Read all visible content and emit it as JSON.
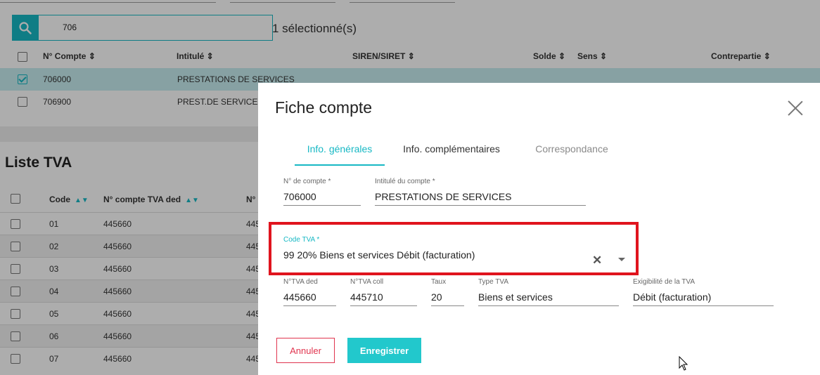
{
  "accounts_panel": {
    "search": {
      "value": "706",
      "icon": "search-icon"
    },
    "selected_text": "1 sélectionné(s)",
    "columns": [
      "N° Compte",
      "Intitulé",
      "SIREN/SIRET",
      "Solde",
      "Sens",
      "Contrepartie"
    ],
    "rows": [
      {
        "num": "706000",
        "label": "PRESTATIONS DE SERVICES",
        "checked": true
      },
      {
        "num": "706900",
        "label": "PREST.DE SERVICES",
        "checked": false
      }
    ]
  },
  "liste_tva": {
    "title": "Liste TVA",
    "columns": [
      "Code",
      "N° compte TVA ded",
      "N°"
    ],
    "rows": [
      {
        "code": "01",
        "ded": "445660",
        "coll": "445"
      },
      {
        "code": "02",
        "ded": "445660",
        "coll": "445"
      },
      {
        "code": "03",
        "ded": "445660",
        "coll": "445"
      },
      {
        "code": "04",
        "ded": "445660",
        "coll": "445"
      },
      {
        "code": "05",
        "ded": "445660",
        "coll": "445"
      },
      {
        "code": "06",
        "ded": "445660",
        "coll": "445"
      },
      {
        "code": "07",
        "ded": "445660",
        "coll": "445"
      }
    ]
  },
  "modal": {
    "title": "Fiche compte",
    "tabs": [
      "Info. générales",
      "Info. complémentaires",
      "Correspondance"
    ],
    "fields": {
      "num_compte": {
        "label": "N° de compte *",
        "value": "706000"
      },
      "intitule": {
        "label": "Intitulé du compte *",
        "value": "PRESTATIONS DE SERVICES"
      },
      "code_tva": {
        "label": "Code TVA *",
        "value": "99 20% Biens et services Débit (facturation)"
      },
      "tva_ded": {
        "label": "N°TVA ded",
        "value": "445660"
      },
      "tva_coll": {
        "label": "N°TVA coll",
        "value": "445710"
      },
      "taux": {
        "label": "Taux",
        "value": "20"
      },
      "type_tva": {
        "label": "Type TVA",
        "value": "Biens et services"
      },
      "exigibilite": {
        "label": "Exigibilité de la TVA",
        "value": "Débit (facturation)"
      }
    },
    "buttons": {
      "cancel": "Annuler",
      "save": "Enregistrer"
    }
  },
  "colors": {
    "accent": "#17b8c4",
    "danger": "#e0344e",
    "highlight": "#e0141e"
  }
}
